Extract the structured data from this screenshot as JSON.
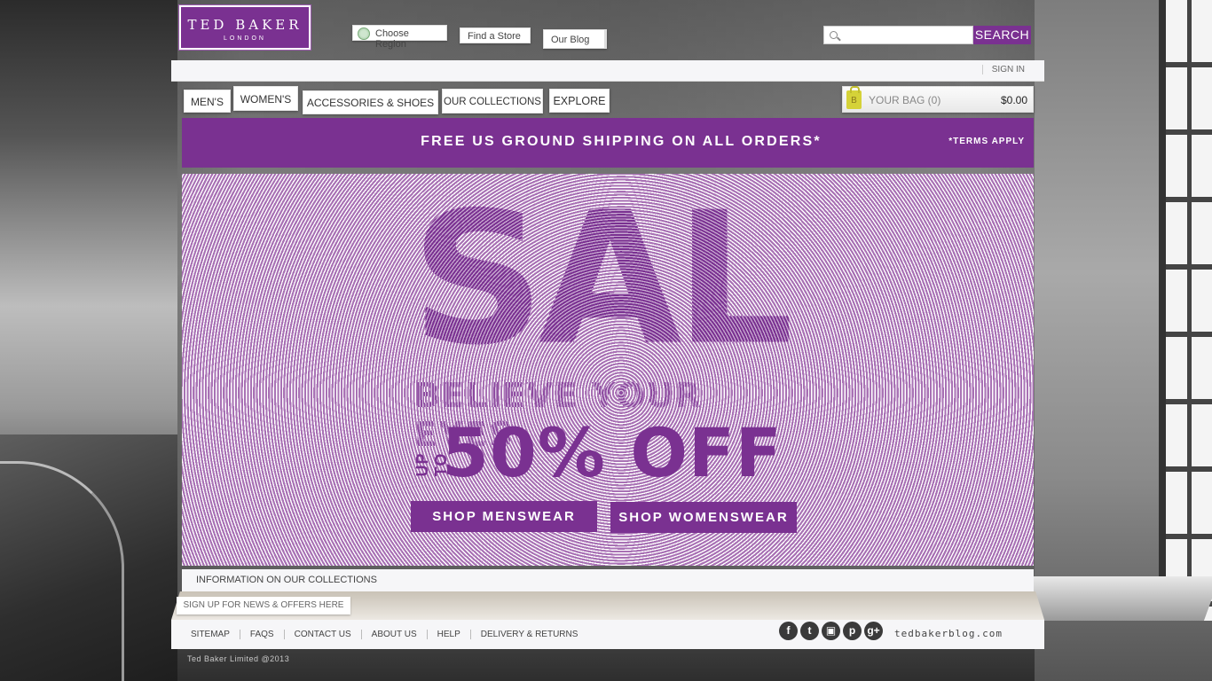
{
  "logo": {
    "line1": "TED BAKER",
    "line2": "LONDON"
  },
  "header": {
    "region_label": "Choose Region",
    "find_store_label": "Find a Store",
    "blog_label": "Our Blog",
    "search_placeholder": "",
    "search_button": "SEARCH",
    "sign_in": "SIGN IN"
  },
  "nav": {
    "items": [
      "MEN'S",
      "WOMEN'S",
      "ACCESSORIES & SHOES",
      "OUR COLLECTIONS",
      "EXPLORE"
    ]
  },
  "bag": {
    "label": "YOUR BAG (0)",
    "total": "$0.00",
    "icon_letter": "B"
  },
  "shipping": {
    "text": "FREE US GROUND SHIPPING ON ALL ORDERS*",
    "terms": "*TERMS APPLY"
  },
  "hero": {
    "headline": "SALE",
    "tagline": "BELIEVE YOUR EYES",
    "up_to": "UP TO",
    "offer": "50% OFF",
    "btn_mens": "SHOP MENSWEAR",
    "btn_womens": "SHOP WOMENSWEAR"
  },
  "info_bar": "INFORMATION ON OUR COLLECTIONS",
  "signup": "SIGN UP FOR NEWS & OFFERS HERE",
  "footer": {
    "links": [
      "SITEMAP",
      "FAQS",
      "CONTACT US",
      "ABOUT US",
      "HELP",
      "DELIVERY & RETURNS"
    ],
    "social": [
      "facebook-icon",
      "twitter-icon",
      "instagram-icon",
      "pinterest-icon",
      "google-plus-icon"
    ],
    "blog": "tedbakerblog.com"
  },
  "copyright": "Ted Baker Limited @2013",
  "colors": {
    "brand_purple": "#7a3191",
    "bag_yellow": "#d5d238"
  }
}
